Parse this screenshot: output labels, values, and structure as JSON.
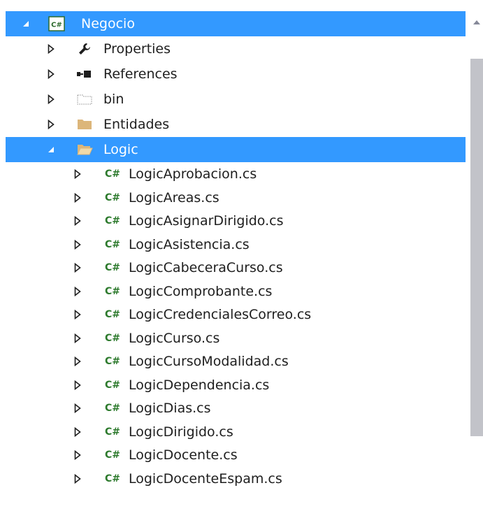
{
  "tree": {
    "project": {
      "label": "Negocio",
      "icon": "csharp-project-icon",
      "expanded": true,
      "selected": true
    },
    "nodes": [
      {
        "label": "Properties",
        "icon": "wrench-icon"
      },
      {
        "label": "References",
        "icon": "references-icon"
      },
      {
        "label": "bin",
        "icon": "dotted-folder-icon"
      },
      {
        "label": "Entidades",
        "icon": "folder-icon"
      }
    ],
    "logic_folder": {
      "label": "Logic",
      "icon": "open-folder-icon",
      "expanded": true,
      "selected": true
    },
    "files": [
      {
        "label": "LogicAprobacion.cs"
      },
      {
        "label": "LogicAreas.cs"
      },
      {
        "label": "LogicAsignarDirigido.cs"
      },
      {
        "label": "LogicAsistencia.cs"
      },
      {
        "label": "LogicCabeceraCurso.cs"
      },
      {
        "label": "LogicComprobante.cs"
      },
      {
        "label": "LogicCredencialesCorreo.cs"
      },
      {
        "label": "LogicCurso.cs"
      },
      {
        "label": "LogicCursoModalidad.cs"
      },
      {
        "label": "LogicDependencia.cs"
      },
      {
        "label": "LogicDias.cs"
      },
      {
        "label": "LogicDirigido.cs"
      },
      {
        "label": "LogicDocente.cs"
      },
      {
        "label": "LogicDocenteEspam.cs"
      }
    ],
    "file_icon_text": "C#",
    "colors": {
      "selection": "#3399ff",
      "csharp_green": "#68217a",
      "folder": "#dcb67a"
    }
  }
}
